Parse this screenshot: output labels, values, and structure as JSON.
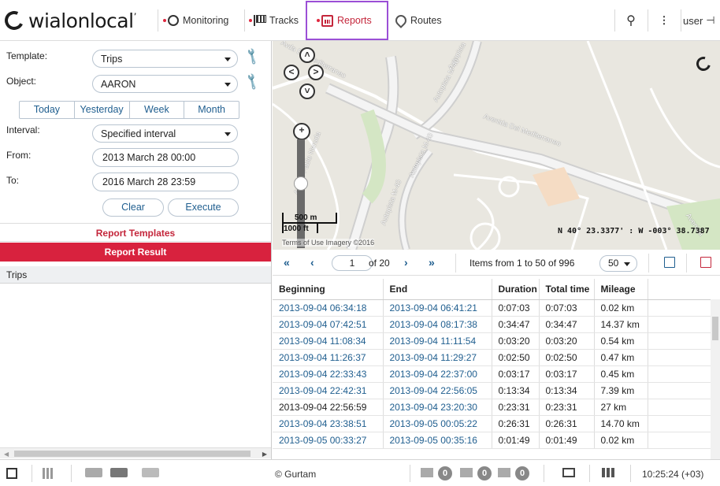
{
  "app": {
    "logo_text": "wialon",
    "logo_text2": "local"
  },
  "nav": {
    "monitoring": "Monitoring",
    "tracks": "Tracks",
    "reports": "Reports",
    "routes": "Routes",
    "user": "user"
  },
  "form": {
    "template_label": "Template:",
    "template_value": "Trips",
    "object_label": "Object:",
    "object_value": "AARON",
    "periods": [
      "Today",
      "Yesterday",
      "Week",
      "Month"
    ],
    "interval_label": "Interval:",
    "interval_value": "Specified interval",
    "from_label": "From:",
    "from_value": "2013 March 28 00:00",
    "to_label": "To:",
    "to_value": "2016 March 28 23:59",
    "clear_label": "Clear",
    "execute_label": "Execute"
  },
  "sections": {
    "templates": "Report Templates",
    "result": "Report Result",
    "trips": "Trips"
  },
  "map": {
    "roads": [
      "Avda Del Mediterraneo",
      "Autopista",
      "Avenida Del Mediterraneo",
      "Autopista M-40",
      "Autopista M-40",
      "Autopista M-40",
      "Av. De Pablo Neruda",
      "Avenida"
    ],
    "scale_m": "500 m",
    "scale_ft": "1000 ft",
    "attribution": "Terms of Use Imagery ©2016",
    "coords": "N 40° 23.3377' : W -003° 38.7387"
  },
  "pager": {
    "page": "1",
    "of": "of 20",
    "items": "Items from 1 to 50 of 996",
    "size": "50"
  },
  "table": {
    "headers": [
      "Beginning",
      "End",
      "Duration",
      "Total time",
      "Mileage"
    ],
    "rows": [
      [
        "2013-09-04 06:34:18",
        "2013-09-04 06:41:21",
        "0:07:03",
        "0:07:03",
        "0.02 km"
      ],
      [
        "2013-09-04 07:42:51",
        "2013-09-04 08:17:38",
        "0:34:47",
        "0:34:47",
        "14.37 km"
      ],
      [
        "2013-09-04 11:08:34",
        "2013-09-04 11:11:54",
        "0:03:20",
        "0:03:20",
        "0.54 km"
      ],
      [
        "2013-09-04 11:26:37",
        "2013-09-04 11:29:27",
        "0:02:50",
        "0:02:50",
        "0.47 km"
      ],
      [
        "2013-09-04 22:33:43",
        "2013-09-04 22:37:00",
        "0:03:17",
        "0:03:17",
        "0.45 km"
      ],
      [
        "2013-09-04 22:42:31",
        "2013-09-04 22:56:05",
        "0:13:34",
        "0:13:34",
        "7.39 km"
      ],
      [
        "2013-09-04 22:56:59",
        "2013-09-04 23:20:30",
        "0:23:31",
        "0:23:31",
        "27 km"
      ],
      [
        "2013-09-04 23:38:51",
        "2013-09-05 00:05:22",
        "0:26:31",
        "0:26:31",
        "14.70 km"
      ],
      [
        "2013-09-05 00:33:27",
        "2013-09-05 00:35:16",
        "0:01:49",
        "0:01:49",
        "0.02 km"
      ]
    ]
  },
  "bottom": {
    "copyright": "© Gurtam",
    "badges": [
      "0",
      "0",
      "0"
    ],
    "clock": "10:25:24 (+03)"
  },
  "colors": {
    "accent": "#d8223e",
    "link": "#1f5e8f",
    "highlight": "#9b4fd6"
  }
}
